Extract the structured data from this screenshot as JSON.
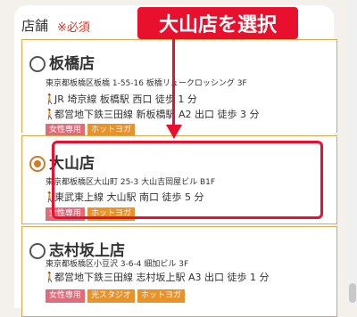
{
  "header": {
    "label": "店舗",
    "required": "※必須"
  },
  "annotation": {
    "text": "大山店を選択"
  },
  "stores": [
    {
      "name": "板橋店",
      "address": "東京都板橋区板橋 1-55-16 板橋リュークロッシング 3F",
      "access": [
        "JR 埼京線 板橋駅 西口 徒歩 1 分",
        "都営地下鉄三田線 新板橋駅 A2 出口 徒歩 3 分"
      ],
      "badges": [
        "女性専用",
        "ホットヨガ"
      ],
      "selected": false
    },
    {
      "name": "大山店",
      "address": "東京都板橋区大山町 25-3 大山吉岡屋ビル B1F",
      "access": [
        "東武東上線 大山駅 南口 徒歩 5 分"
      ],
      "badges": [
        "女性専用",
        "ホットヨガ"
      ],
      "selected": true
    },
    {
      "name": "志村坂上店",
      "address": "東京都板橋区小豆沢 3-6-4 細加ビル 3F",
      "access": [
        "都営地下鉄三田線 志村坂上駅 A3 出口 徒歩 1 分"
      ],
      "badges": [
        "女性専用",
        "光スタジオ",
        "ホットヨガ"
      ],
      "selected": false
    }
  ],
  "colors": {
    "accent": "#e8102c",
    "border": "#d9a84f",
    "walk_icon": "#e58a1f",
    "badge_women": "#e26b7a",
    "badge_hot": "#e9922a"
  }
}
